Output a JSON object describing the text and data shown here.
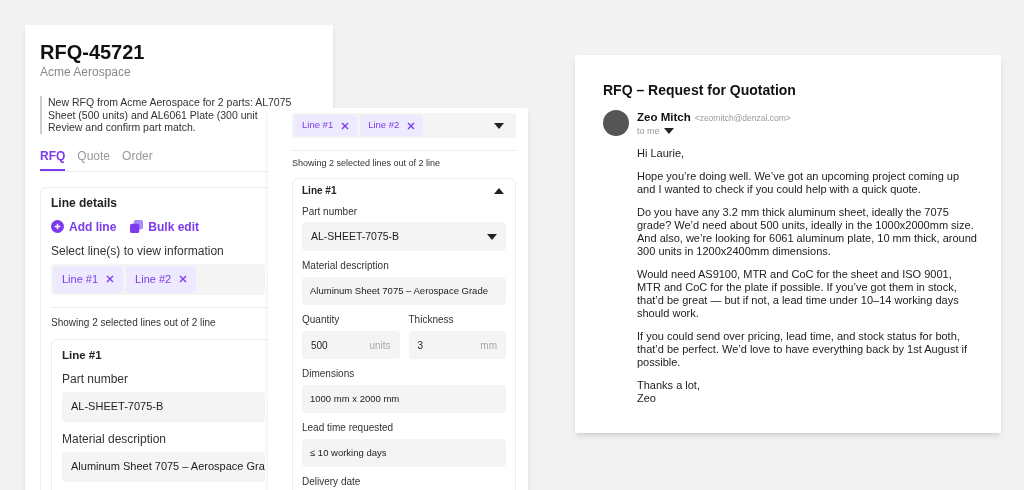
{
  "rfq_panel": {
    "title": "RFQ-45721",
    "company": "Acme Aerospace",
    "summary_lines": [
      "New RFQ from Acme Aerospace for 2 parts: AL7075",
      "Sheet (500 units) and AL6061 Plate (300 unit",
      "Review and confirm part match."
    ],
    "tabs": [
      {
        "label": "RFQ",
        "selected": true
      },
      {
        "label": "Quote",
        "selected": false
      },
      {
        "label": "Order",
        "selected": false
      }
    ],
    "line_details": {
      "title": "Line details",
      "actions": [
        {
          "kind": "add",
          "label": "Add line"
        },
        {
          "kind": "bulk",
          "label": "Bulk edit"
        }
      ],
      "select_label": "Select line(s) to view information",
      "chips": [
        {
          "label": "Line #1"
        },
        {
          "label": "Line #2"
        }
      ],
      "showing_text": "Showing 2 selected lines out of 2 line",
      "line": {
        "title": "Line #1",
        "fields": [
          {
            "label": "Part number",
            "value": "AL-SHEET-7075-B"
          },
          {
            "label": "Material description",
            "value": "Aluminum Sheet 7075 – Aerospace Gra"
          }
        ]
      }
    }
  },
  "line_panel": {
    "chips": [
      {
        "label": "Line #1"
      },
      {
        "label": "Line #2"
      }
    ],
    "showing_text": "Showing 2 selected lines out of 2 line",
    "line": {
      "title": "Line #1",
      "expanded": true,
      "fields": [
        {
          "kind": "select",
          "label": "Part number",
          "value": "AL-SHEET-7075-B"
        },
        {
          "kind": "text",
          "label": "Material description",
          "value": "Aluminum Sheet 7075 – Aerospace Grade"
        },
        {
          "kind": "pair",
          "items": [
            {
              "label": "Quantity",
              "value": "500",
              "unit": "units"
            },
            {
              "label": "Thickness",
              "value": "3",
              "unit": "mm"
            }
          ]
        },
        {
          "kind": "text",
          "label": "Dimensions",
          "value": "1000 mm x 2000 mm"
        },
        {
          "kind": "text",
          "label": "Lead time requested",
          "value": "≤ 10 working days"
        },
        {
          "kind": "label",
          "label": "Delivery date"
        }
      ]
    }
  },
  "email": {
    "subject": "RFQ – Request for Quotation",
    "sender_name": "Zeo Mitch",
    "sender_email": "<zeomitch@denzal.com>",
    "recipient": "to me",
    "greeting": "Hi Laurie,",
    "paragraphs": [
      "Hope you’re doing well. We’ve got an upcoming project coming up and I wanted to check if you could help with a quick quote.",
      "Do you have any 3.2 mm thick aluminum sheet, ideally the 7075 grade? We’d need about 500 units, ideally in the 1000x2000mm size. And also, we’re looking for 6061 aluminum plate, 10 mm thick, around 300 units in 1200x2400mm dimensions.",
      "Would need AS9100, MTR and CoC for the sheet and ISO 9001, MTR and CoC for the plate if possible. If you’ve got them in stock, that’d be great — but if not, a lead time under 10–14 working days should work.",
      "If you could send over pricing, lead time, and stock status for both, that’d be perfect. We’d love to have everything back by 1st August if possible."
    ],
    "signoff_lines": [
      "Thanks a lot,",
      "Zeo"
    ]
  }
}
